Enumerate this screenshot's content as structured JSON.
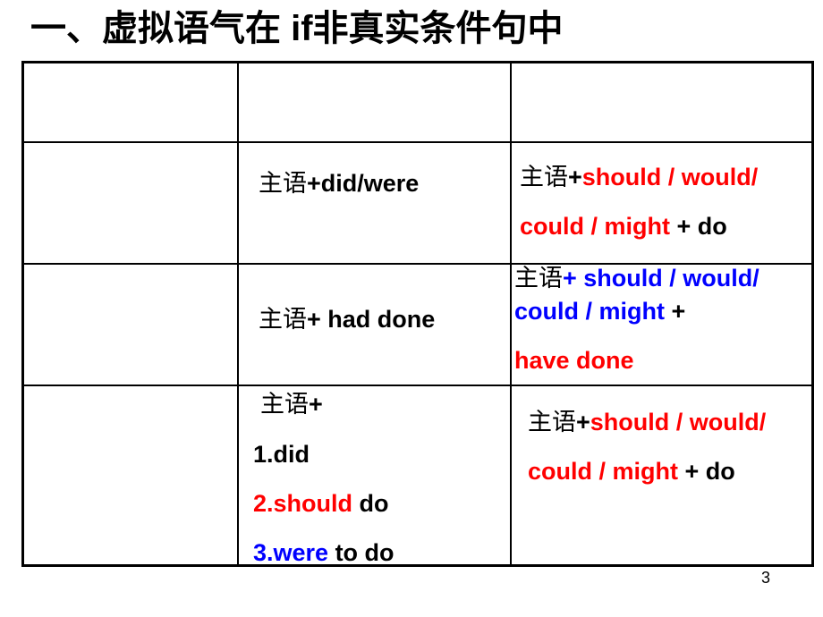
{
  "slide": {
    "title": "一、虚拟语气在 if非真实条件句中",
    "page_number": "3"
  },
  "table": {
    "header_row": [
      "",
      "",
      ""
    ],
    "rows": [
      {
        "label": "",
        "condition": {
          "line1": {
            "subject": "主语",
            "rest": "+did/were"
          }
        },
        "result": {
          "line1": {
            "subject": "主语",
            "plus": "+",
            "modals": "should / would/"
          },
          "line2": {
            "modals": "could / might",
            "tail": " + do"
          }
        }
      },
      {
        "label": "",
        "condition": {
          "line1": {
            "subject": "主语",
            "rest": "+ had done"
          }
        },
        "result": {
          "line1": {
            "subject": "主语",
            "modals": "+ should / would/"
          },
          "line2": {
            "modals": "could / might",
            "tail": " +"
          },
          "line3": {
            "verb": "have done"
          }
        }
      },
      {
        "label": "",
        "condition": {
          "line1": {
            "subject": "主语",
            "rest": "+"
          },
          "item1": {
            "text": "1.did"
          },
          "item2": {
            "highlight": "2.should",
            "tail": " do"
          },
          "item3": {
            "highlight": "3.were",
            "tail": " to do"
          }
        },
        "result": {
          "line1": {
            "subject": "主语",
            "plus": "+",
            "modals": "should / would/"
          },
          "line2": {
            "modals": "could / might",
            "tail": " + do"
          }
        }
      }
    ]
  },
  "colors": {
    "red": "#ff0000",
    "blue": "#0000ff",
    "text": "#000000"
  }
}
